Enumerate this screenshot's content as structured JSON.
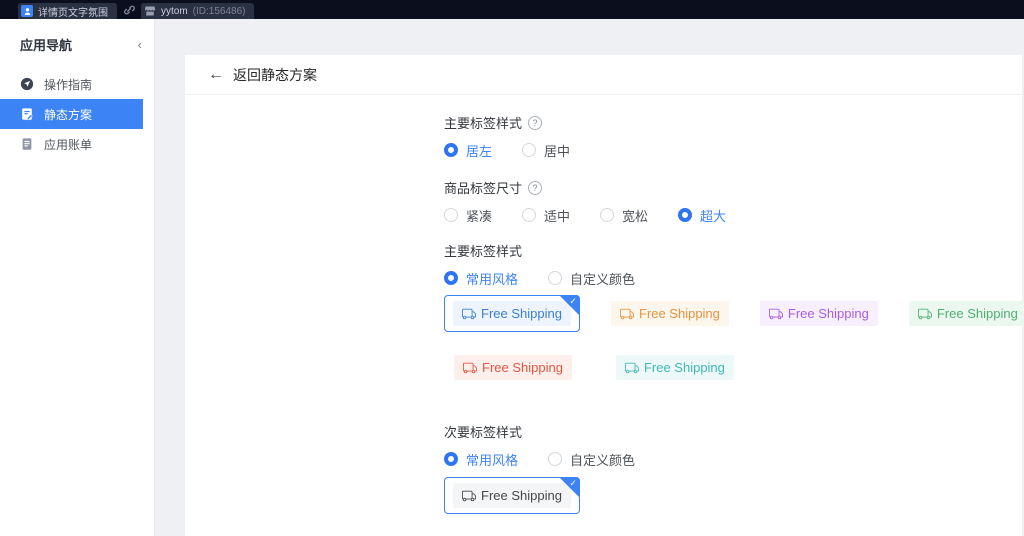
{
  "accent": "#3c83f6",
  "glyphs": {
    "back_arrow": "←",
    "collapse": "‹",
    "help": "?",
    "check": "✓"
  },
  "topbar": {
    "app_tab_label": "详情页文字氛围",
    "shop_name": "yytom",
    "shop_id": "(ID:156486)"
  },
  "sidebar": {
    "title": "应用导航",
    "items": [
      {
        "label": "操作指南"
      },
      {
        "label": "静态方案"
      },
      {
        "label": "应用账单"
      }
    ]
  },
  "main": {
    "back_label": "返回静态方案",
    "groups": {
      "align": {
        "label": "主要标签样式",
        "options": [
          {
            "label": "居左"
          },
          {
            "label": "居中"
          }
        ]
      },
      "size": {
        "label": "商品标签尺寸",
        "options": [
          {
            "label": "紧凑"
          },
          {
            "label": "适中"
          },
          {
            "label": "宽松"
          },
          {
            "label": "超大"
          }
        ]
      },
      "primary_style": {
        "label": "主要标签样式",
        "options": [
          {
            "label": "常用风格"
          },
          {
            "label": "自定义颜色"
          }
        ]
      },
      "secondary_style": {
        "label": "次要标签样式",
        "options": [
          {
            "label": "常用风格"
          },
          {
            "label": "自定义颜色"
          }
        ]
      }
    },
    "tag_text": "Free Shipping",
    "primary_presets": [
      {
        "name": "blue",
        "bg": "#eef4fd",
        "fg": "#3d7fd0",
        "selected": true
      },
      {
        "name": "orange",
        "bg": "#fdf6ec",
        "fg": "#e8923e"
      },
      {
        "name": "purple",
        "bg": "#f8effe",
        "fg": "#a55fe0"
      },
      {
        "name": "green",
        "bg": "#ebf8f0",
        "fg": "#53ae71"
      },
      {
        "name": "red",
        "bg": "#fdefec",
        "fg": "#e05843"
      },
      {
        "name": "teal",
        "bg": "#ecf9f8",
        "fg": "#43b8b4"
      }
    ],
    "secondary_presets": [
      {
        "name": "gray",
        "bg": "#f4f5f6",
        "fg": "#474747",
        "selected": true
      }
    ]
  }
}
